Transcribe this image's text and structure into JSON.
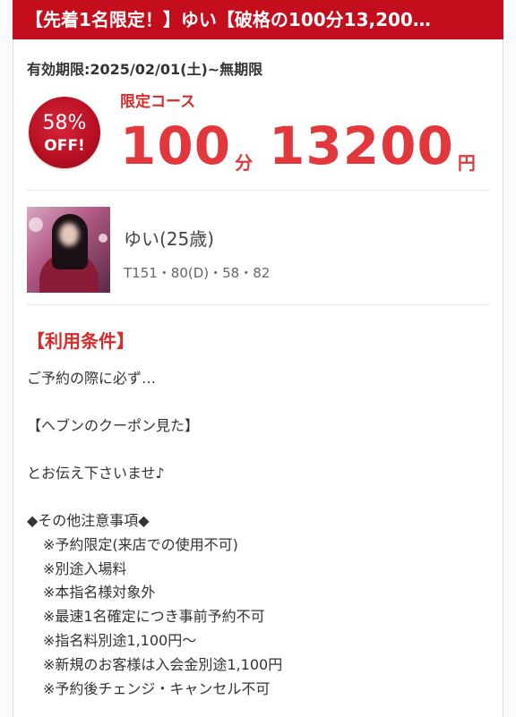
{
  "header": {
    "title": "【先着1名限定！】ゆい【破格の100分13,200…"
  },
  "coupon": {
    "validity": "有効期限:2025/02/01(土)~無期限",
    "discount_percent": "58%",
    "discount_off": "OFF!",
    "course_label": "限定コース",
    "duration": "100",
    "duration_unit": "分",
    "price": "13200",
    "price_unit": "円"
  },
  "girl": {
    "name": "ゆい(25歳)",
    "stats": "T151・80(D)・58・82"
  },
  "terms": {
    "title": "【利用条件】",
    "intro_1": "ご予約の際に必ず…",
    "intro_2": "【ヘブンのクーポン見た】",
    "intro_3": "とお伝え下さいませ♪",
    "other_heading": "◆その他注意事項◆",
    "notes": [
      "※予約限定(来店での使用不可)",
      "※別途入場料",
      "※本指名様対象外",
      "※最速1名確定につき事前予約不可",
      "※指名料別途1,100円～",
      "※新規のお客様は入会金別途1,100円",
      "※予約後チェンジ・キャンセル不可"
    ]
  },
  "colors": {
    "header_bg": "#c40e1d",
    "accent_red": "#e2373b",
    "badge_red": "#b60f22"
  }
}
